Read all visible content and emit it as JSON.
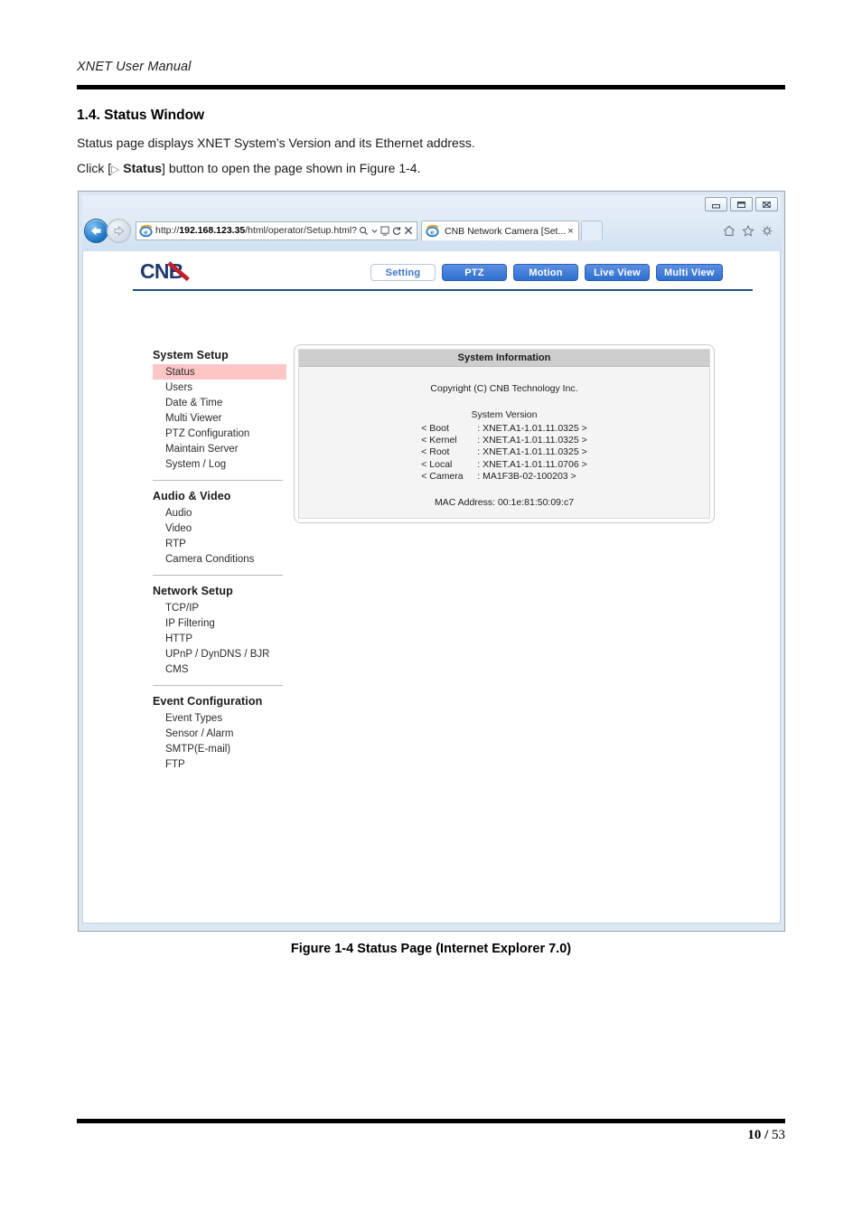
{
  "document": {
    "running_header": "XNET User Manual",
    "section_number_title": "1.4. Status Window",
    "paragraph_1": "Status page displays XNET System’s Version and its Ethernet address.",
    "paragraph_2_prefix": "Click [",
    "paragraph_2_triangle": "▷",
    "paragraph_2_bold": "Status",
    "paragraph_2_suffix": "] button to open the page shown in Figure 1-4.",
    "figure_caption": "Figure 1-4 Status Page (Internet Explorer 7.0)",
    "footer_current_page": "10",
    "footer_separator": "/",
    "footer_total_pages": "53"
  },
  "browser": {
    "window_controls": {
      "minimize": "minimize-icon",
      "maximize": "maximize-icon",
      "close": "close-icon"
    },
    "back_button": "back-icon",
    "forward_button": "forward-icon",
    "address_bar": {
      "favicon": "ie-icon",
      "url_host": "192.168.123.35",
      "url_scheme": "http://",
      "url_path": "/html/operator/Setup.html?",
      "search_icon": "search-icon",
      "compatibility_icon": "compatibility-view-icon",
      "refresh_icon": "refresh-icon",
      "stop_icon": "stop-icon"
    },
    "tab": {
      "favicon": "ie-icon",
      "title": "CNB Network Camera [Set...",
      "close": "×"
    },
    "toolbar_icons": {
      "home": "home-icon",
      "favorites": "star-icon",
      "tools": "gear-icon"
    }
  },
  "webpage": {
    "logo_text": "CNB",
    "nav_buttons": [
      {
        "label": "Setting",
        "active": true
      },
      {
        "label": "PTZ",
        "active": false
      },
      {
        "label": "Motion",
        "active": false
      },
      {
        "label": "Live View",
        "active": false
      },
      {
        "label": "Multi View",
        "active": false
      }
    ],
    "sidebar": {
      "groups": [
        {
          "title": "System Setup",
          "items": [
            {
              "label": "Status",
              "selected": true
            },
            {
              "label": "Users",
              "selected": false
            },
            {
              "label": "Date & Time",
              "selected": false
            },
            {
              "label": "Multi Viewer",
              "selected": false
            },
            {
              "label": "PTZ Configuration",
              "selected": false
            },
            {
              "label": "Maintain Server",
              "selected": false
            },
            {
              "label": "System / Log",
              "selected": false
            }
          ]
        },
        {
          "title": "Audio & Video",
          "items": [
            {
              "label": "Audio",
              "selected": false
            },
            {
              "label": "Video",
              "selected": false
            },
            {
              "label": "RTP",
              "selected": false
            },
            {
              "label": "Camera Conditions",
              "selected": false
            }
          ]
        },
        {
          "title": "Network Setup",
          "items": [
            {
              "label": "TCP/IP",
              "selected": false
            },
            {
              "label": "IP Filtering",
              "selected": false
            },
            {
              "label": "HTTP",
              "selected": false
            },
            {
              "label": "UPnP / DynDNS / BJR",
              "selected": false
            },
            {
              "label": "CMS",
              "selected": false
            }
          ]
        },
        {
          "title": "Event Configuration",
          "items": [
            {
              "label": "Event Types",
              "selected": false
            },
            {
              "label": "Sensor / Alarm",
              "selected": false
            },
            {
              "label": "SMTP(E-mail)",
              "selected": false
            },
            {
              "label": "FTP",
              "selected": false
            }
          ]
        }
      ]
    },
    "system_information": {
      "panel_title": "System Information",
      "copyright": "Copyright (C) CNB Technology Inc.",
      "version_heading": "System Version",
      "versions": [
        {
          "name": "< Boot",
          "value": ": XNET.A1-1.01.11.0325 >"
        },
        {
          "name": "< Kernel",
          "value": ": XNET.A1-1.01.11.0325 >"
        },
        {
          "name": "< Root",
          "value": ": XNET.A1-1.01.11.0325 >"
        },
        {
          "name": "< Local",
          "value": ": XNET.A1-1.01.11.0706 >"
        },
        {
          "name": "< Camera",
          "value": ": MA1F3B-02-100203 >"
        }
      ],
      "mac_address": "MAC Address: 00:1e:81:50:09:c7"
    }
  },
  "colors": {
    "nav_active_text": "#3b74cc",
    "nav_button_blue": "#2f6fd0",
    "sidebar_selected_bg": "#fbc6c3",
    "header_rule": "#1f4e86",
    "logo_navy": "#1f3a6e",
    "logo_red": "#c4202c"
  }
}
